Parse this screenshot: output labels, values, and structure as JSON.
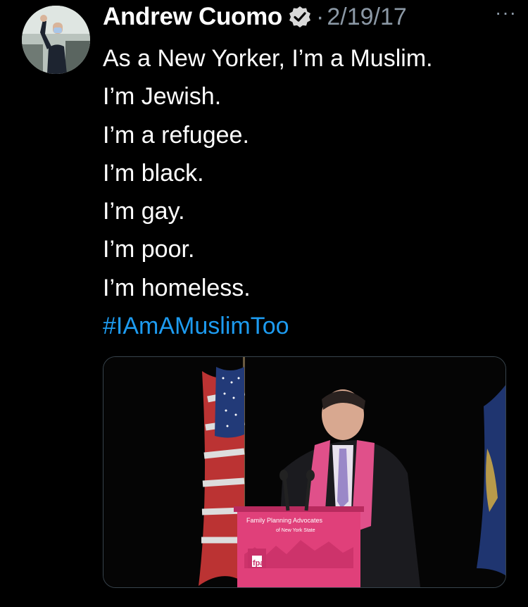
{
  "tweet": {
    "author_name": "Andrew Cuomo",
    "separator": "·",
    "date": "2/19/17",
    "more_label": "···",
    "lines": [
      "As a New Yorker, I’m a Muslim.",
      "I’m Jewish.",
      "I’m a refugee.",
      "I’m black.",
      "I’m gay.",
      "I’m poor.",
      "I’m homeless."
    ],
    "hashtag": "#IAmAMuslimToo"
  },
  "media": {
    "podium_line1": "Family Planning Advocates",
    "podium_line2": "of New York State",
    "podium_logo": "fpa"
  },
  "colors": {
    "background": "#000000",
    "text": "#ffffff",
    "muted": "#8b98a5",
    "link": "#1d9bf0",
    "podium_pink": "#e0407a"
  },
  "icons": {
    "verified": "verified-badge-icon",
    "more": "more-options-icon"
  }
}
